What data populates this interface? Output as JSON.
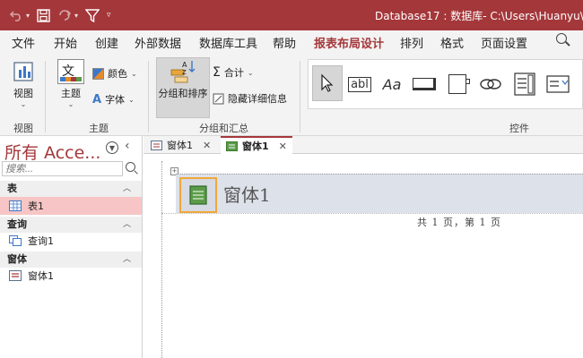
{
  "window": {
    "title": "Database17 : 数据库- C:\\Users\\Huanyu\\Docu"
  },
  "menu": {
    "tabs": [
      {
        "label": "文件"
      },
      {
        "label": "开始"
      },
      {
        "label": "创建"
      },
      {
        "label": "外部数据"
      },
      {
        "label": "数据库工具"
      },
      {
        "label": "帮助"
      },
      {
        "label": "报表布局设计"
      },
      {
        "label": "排列"
      },
      {
        "label": "格式"
      },
      {
        "label": "页面设置"
      }
    ],
    "active_tab": "报表布局设计"
  },
  "ribbon": {
    "view": {
      "button": "视图",
      "group": "视图"
    },
    "theme": {
      "button": "主题",
      "colors": "颜色",
      "fonts": "字体",
      "group": "主题",
      "text_icon": "文"
    },
    "grouping": {
      "sort_button": "分组和排序",
      "totals": "合计",
      "hide_details": "隐藏详细信息",
      "group": "分组和汇总"
    },
    "controls": {
      "group": "控件",
      "textbox": "abl",
      "label": "Aa"
    }
  },
  "nav": {
    "title": "所有 Acce...",
    "search_placeholder": "搜索...",
    "sections": [
      {
        "label": "表",
        "items": [
          {
            "label": "表1",
            "selected": true
          }
        ]
      },
      {
        "label": "查询",
        "items": [
          {
            "label": "查询1",
            "selected": false
          }
        ]
      },
      {
        "label": "窗体",
        "items": [
          {
            "label": "窗体1",
            "selected": false
          }
        ]
      }
    ]
  },
  "documents": {
    "tabs": [
      {
        "label": "窗体1",
        "active": false
      },
      {
        "label": "窗体1",
        "active": true
      }
    ]
  },
  "report": {
    "title": "窗体1",
    "page_footer": "共 1 页，第 1 页"
  },
  "colors": {
    "accent": "#a4373a",
    "header_band": "#dde1ea",
    "selection": "#f7c5c5",
    "highlight_border": "#f0a73a"
  }
}
